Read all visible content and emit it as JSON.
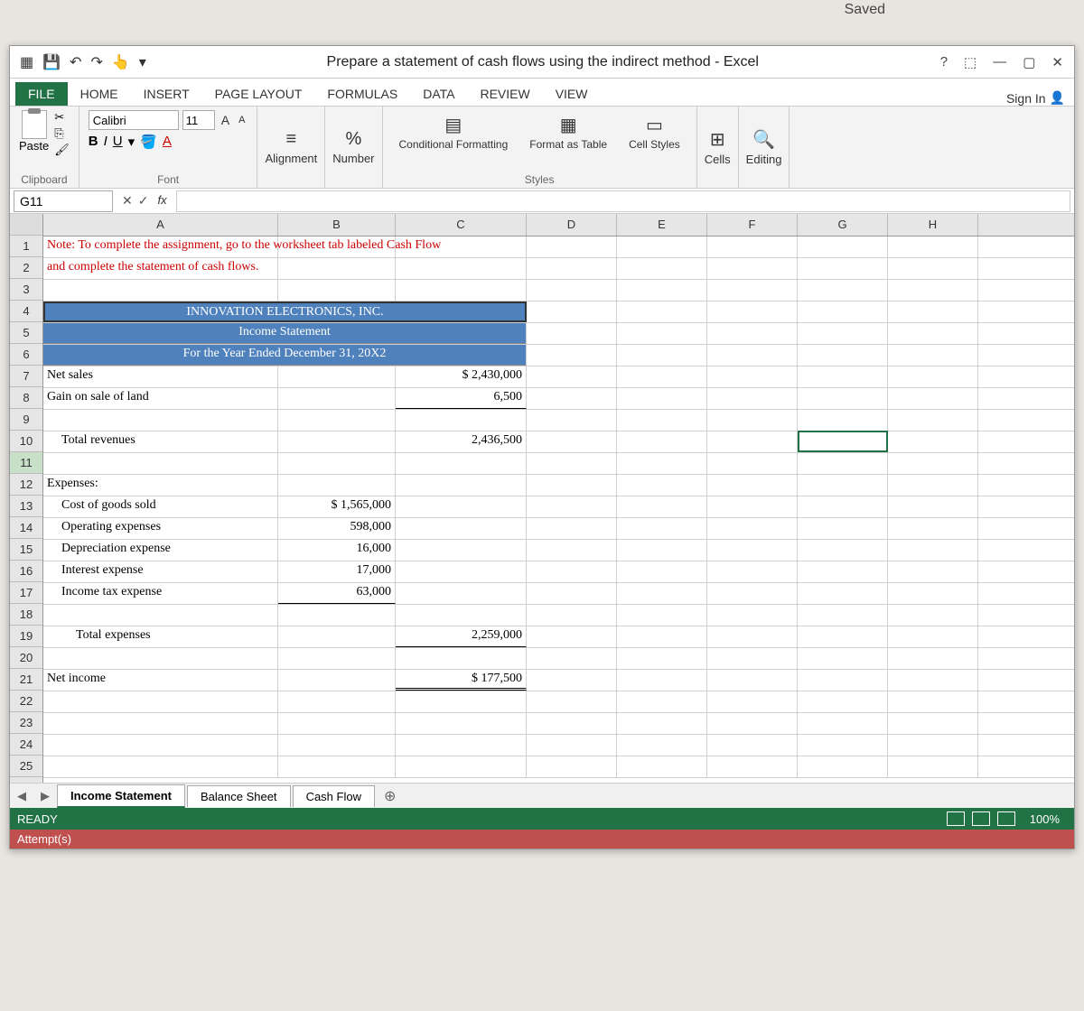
{
  "saved": "Saved",
  "qat": {
    "undo": "↶",
    "redo": "↷"
  },
  "title": "Prepare a statement of cash flows using the indirect method - Excel",
  "winctrl": {
    "help": "?",
    "ribbon": "⬚",
    "min": "—",
    "max": "▢",
    "close": "✕"
  },
  "menu": {
    "file": "FILE",
    "home": "HOME",
    "insert": "INSERT",
    "pagelayout": "PAGE LAYOUT",
    "formulas": "FORMULAS",
    "data": "DATA",
    "review": "REVIEW",
    "view": "VIEW"
  },
  "signin": "Sign In",
  "ribbon": {
    "paste": "Paste",
    "clipboard": "Clipboard",
    "fontname": "Calibri",
    "fontsize": "11",
    "font": "Font",
    "bold": "B",
    "italic": "I",
    "underline": "U",
    "alignment": "Alignment",
    "number": "Number",
    "conditional": "Conditional Formatting",
    "formatas": "Format as Table",
    "cellstyles": "Cell Styles",
    "styles": "Styles",
    "cells": "Cells",
    "editing": "Editing"
  },
  "namebox": "G11",
  "fx": {
    "cancel": "✕",
    "enter": "✓",
    "fx": "fx"
  },
  "cols": {
    "A": "A",
    "B": "B",
    "C": "C",
    "D": "D",
    "E": "E",
    "F": "F",
    "G": "G",
    "H": "H"
  },
  "rows": [
    "1",
    "2",
    "3",
    "4",
    "5",
    "6",
    "7",
    "8",
    "9",
    "10",
    "11",
    "12",
    "13",
    "14",
    "15",
    "16",
    "17",
    "18",
    "19",
    "20",
    "21",
    "22",
    "23",
    "24",
    "25"
  ],
  "cells": {
    "a1": "Note: To complete the assignment, go to the worksheet tab labeled Cash Flow",
    "a2": "and complete the statement of cash flows.",
    "a4": "INNOVATION ELECTRONICS, INC.",
    "a5": "Income Statement",
    "a6": "For the Year Ended December 31, 20X2",
    "a7": "Net sales",
    "c7": "$   2,430,000",
    "a8": "Gain on sale of land",
    "c8": "6,500",
    "a10": "Total revenues",
    "c10": "2,436,500",
    "a12": "Expenses:",
    "a13": "Cost of goods sold",
    "b13": "$   1,565,000",
    "a14": "Operating expenses",
    "b14": "598,000",
    "a15": "Depreciation expense",
    "b15": "16,000",
    "a16": "Interest expense",
    "b16": "17,000",
    "a17": "Income tax expense",
    "b17": "63,000",
    "a19": "Total expenses",
    "c19": "2,259,000",
    "a21": "Net income",
    "c21": "$       177,500"
  },
  "tabs": {
    "t1": "Income Statement",
    "t2": "Balance Sheet",
    "t3": "Cash Flow"
  },
  "status": {
    "ready": "READY",
    "zoom": "100%",
    "attempts": "Attempt(s)"
  }
}
